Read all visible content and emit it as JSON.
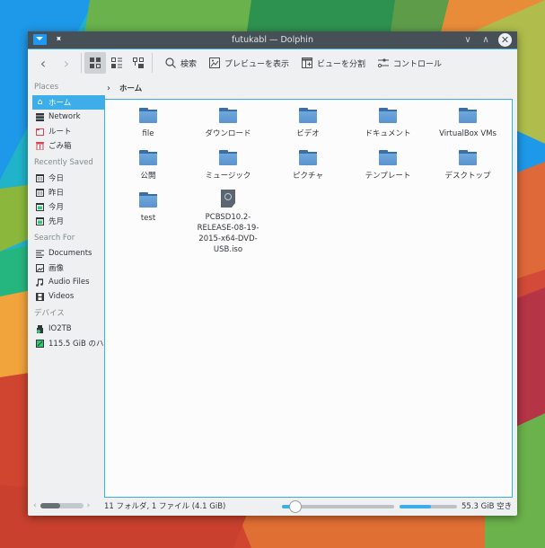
{
  "window": {
    "title": "futukabl — Dolphin",
    "buttons": {
      "minimize": "∨",
      "maximize": "∧",
      "close": "✕"
    }
  },
  "toolbar": {
    "back": "‹",
    "forward": "›",
    "search_label": "検索",
    "preview_label": "プレビューを表示",
    "split_label": "ビューを分割",
    "control_label": "コントロール"
  },
  "breadcrumb": {
    "separator": "›",
    "current": "ホーム"
  },
  "sidebar": {
    "places_title": "Places",
    "places": [
      {
        "label": "ホーム",
        "icon": "home-icon",
        "selected": true
      },
      {
        "label": "Network",
        "icon": "network-icon"
      },
      {
        "label": "ルート",
        "icon": "root-folder-icon"
      },
      {
        "label": "ごみ箱",
        "icon": "trash-icon"
      }
    ],
    "recent_title": "Recently Saved",
    "recent": [
      {
        "label": "今日",
        "icon": "calendar-icon"
      },
      {
        "label": "昨日",
        "icon": "calendar-icon"
      },
      {
        "label": "今月",
        "icon": "calendar-icon"
      },
      {
        "label": "先月",
        "icon": "calendar-icon"
      }
    ],
    "search_title": "Search For",
    "search": [
      {
        "label": "Documents",
        "icon": "document-icon"
      },
      {
        "label": "画像",
        "icon": "image-icon"
      },
      {
        "label": "Audio Files",
        "icon": "music-icon"
      },
      {
        "label": "Videos",
        "icon": "video-icon"
      }
    ],
    "devices_title": "デバイス",
    "devices": [
      {
        "label": "IO2TB",
        "icon": "usb-drive-icon"
      },
      {
        "label": "115.5 GiB のハ",
        "icon": "hard-drive-icon"
      }
    ]
  },
  "files": [
    {
      "name": "file",
      "type": "folder"
    },
    {
      "name": "ダウンロード",
      "type": "folder"
    },
    {
      "name": "ビデオ",
      "type": "folder"
    },
    {
      "name": "ドキュメント",
      "type": "folder"
    },
    {
      "name": "VirtualBox VMs",
      "type": "folder"
    },
    {
      "name": "公開",
      "type": "folder"
    },
    {
      "name": "ミュージック",
      "type": "folder"
    },
    {
      "name": "ピクチャ",
      "type": "folder"
    },
    {
      "name": "テンプレート",
      "type": "folder"
    },
    {
      "name": "デスクトップ",
      "type": "folder"
    },
    {
      "name": "test",
      "type": "folder"
    },
    {
      "name": "PCBSD10.2-RELEASE-08-19-2015-x64-DVD-USB.iso",
      "type": "iso"
    }
  ],
  "file_name_lines": {
    "iso": [
      "PCBSD10.2-",
      "RELEASE-08-19-",
      "2015-x64-DVD-",
      "USB.iso"
    ]
  },
  "statusbar": {
    "summary": "11 フォルダ, 1 ファイル (4.1 GiB)",
    "zoom_level_fraction": 0.12,
    "disk_used_fraction": 0.55,
    "free_space": "55.3 GiB 空き",
    "scroll_left": "‹",
    "scroll_right": "›"
  },
  "colors": {
    "accent": "#3daee9",
    "titlebar": "#475057",
    "folder": "#5a93cf",
    "folder_tab": "#3b6ea5"
  }
}
